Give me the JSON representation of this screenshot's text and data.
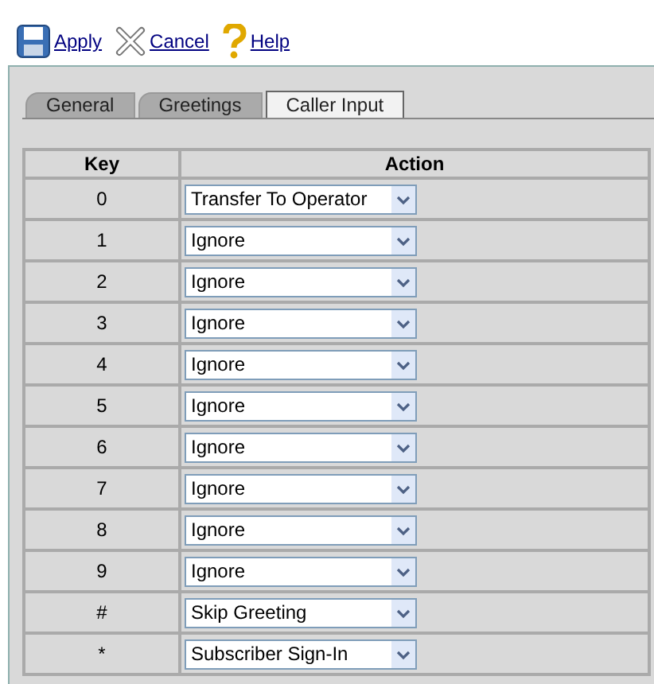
{
  "toolbar": [
    {
      "kind": "save",
      "label": "Apply"
    },
    {
      "kind": "cancel",
      "label": "Cancel"
    },
    {
      "kind": "help",
      "label": "Help"
    }
  ],
  "tabs": [
    {
      "label": "General",
      "selected": false
    },
    {
      "label": "Greetings",
      "selected": false
    },
    {
      "label": "Caller Input",
      "selected": true
    }
  ],
  "table": {
    "columns": [
      "Key",
      "Action"
    ],
    "rows": [
      {
        "key": "0",
        "action": "Transfer To Operator"
      },
      {
        "key": "1",
        "action": "Ignore"
      },
      {
        "key": "2",
        "action": "Ignore"
      },
      {
        "key": "3",
        "action": "Ignore"
      },
      {
        "key": "4",
        "action": "Ignore"
      },
      {
        "key": "5",
        "action": "Ignore"
      },
      {
        "key": "6",
        "action": "Ignore"
      },
      {
        "key": "7",
        "action": "Ignore"
      },
      {
        "key": "8",
        "action": "Ignore"
      },
      {
        "key": "9",
        "action": "Ignore"
      },
      {
        "key": "#",
        "action": "Skip Greeting"
      },
      {
        "key": "*",
        "action": "Subscriber Sign-In"
      }
    ]
  }
}
